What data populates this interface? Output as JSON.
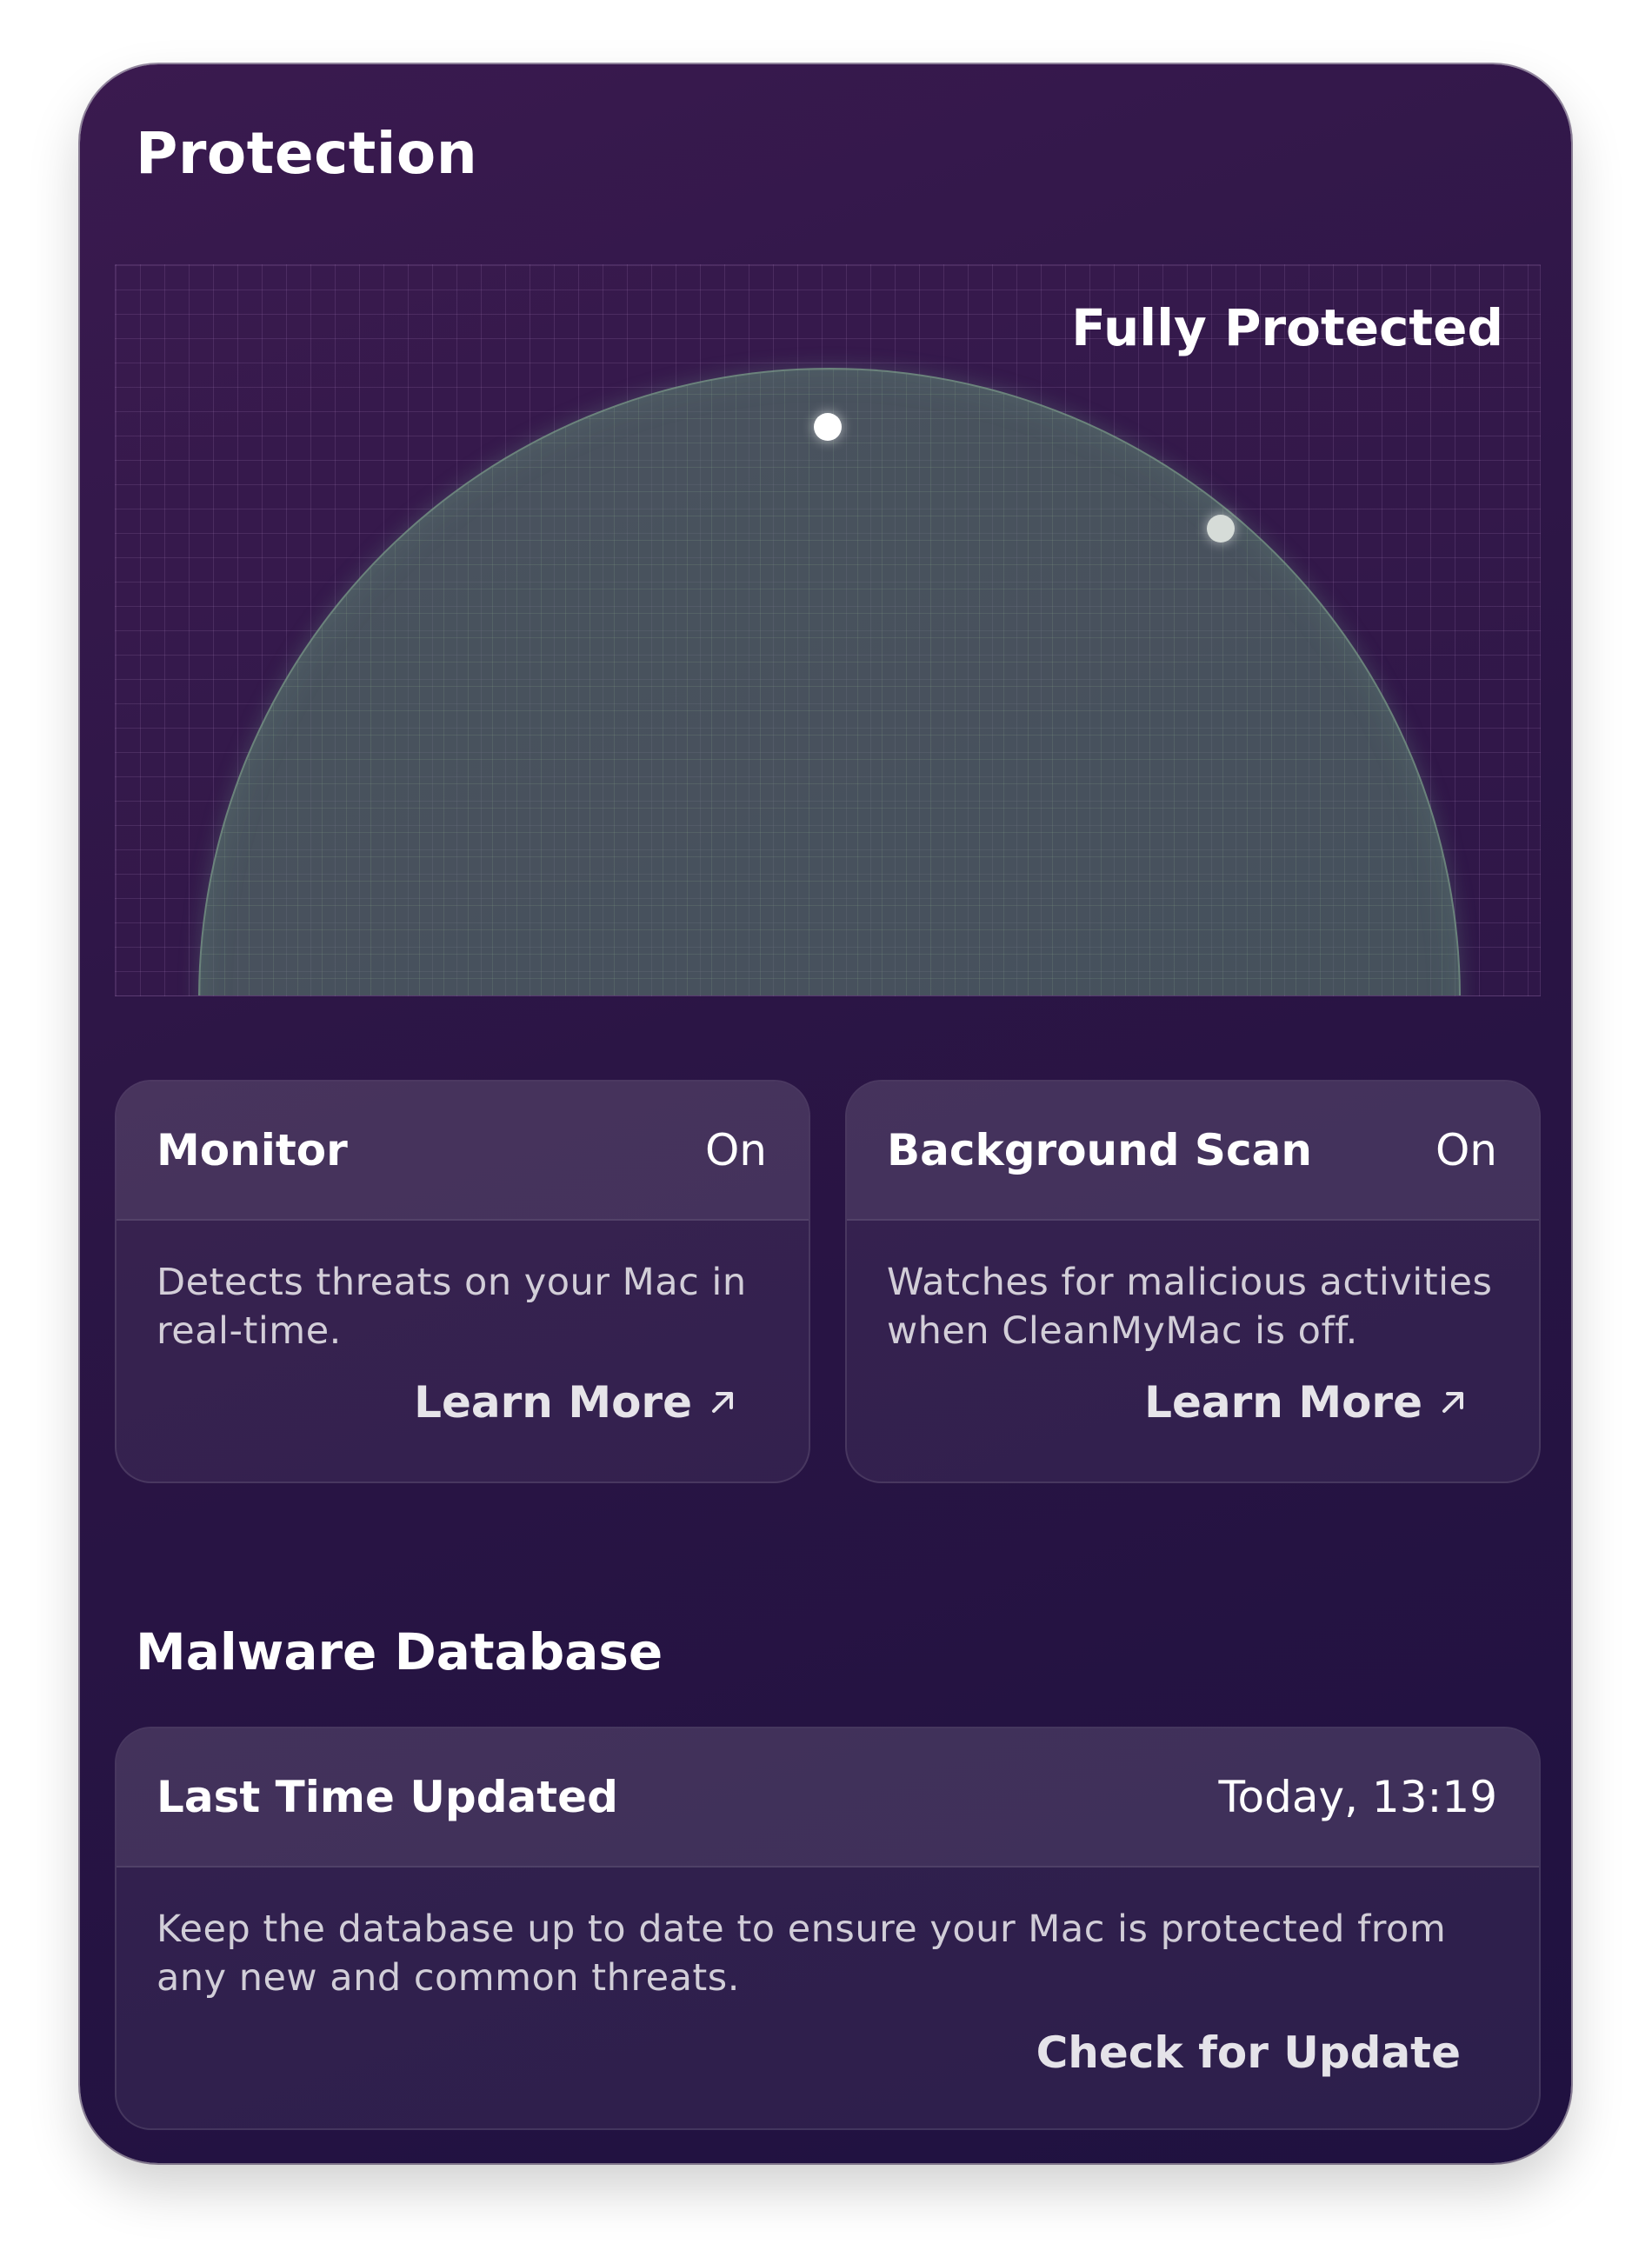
{
  "window": {
    "title": "Protection"
  },
  "radar": {
    "status": "Fully Protected",
    "colors": {
      "dome": "#5a826e",
      "background": "#2b1545"
    }
  },
  "monitor": {
    "title": "Monitor",
    "value": "On",
    "description": "Detects threats on your Mac in real-time.",
    "link": "Learn More",
    "link_icon": "arrow-up-right-icon"
  },
  "background_scan": {
    "title": "Background Scan",
    "value": "On",
    "description": "Watches for malicious activities when CleanMyMac is off.",
    "link": "Learn More",
    "link_icon": "arrow-up-right-icon"
  },
  "malware_database": {
    "section_title": "Malware Database",
    "title": "Last Time Updated",
    "value": "Today, 13:19",
    "description": "Keep the database up to date to ensure your Mac is protected from any new and common threats.",
    "action": "Check for Update"
  }
}
